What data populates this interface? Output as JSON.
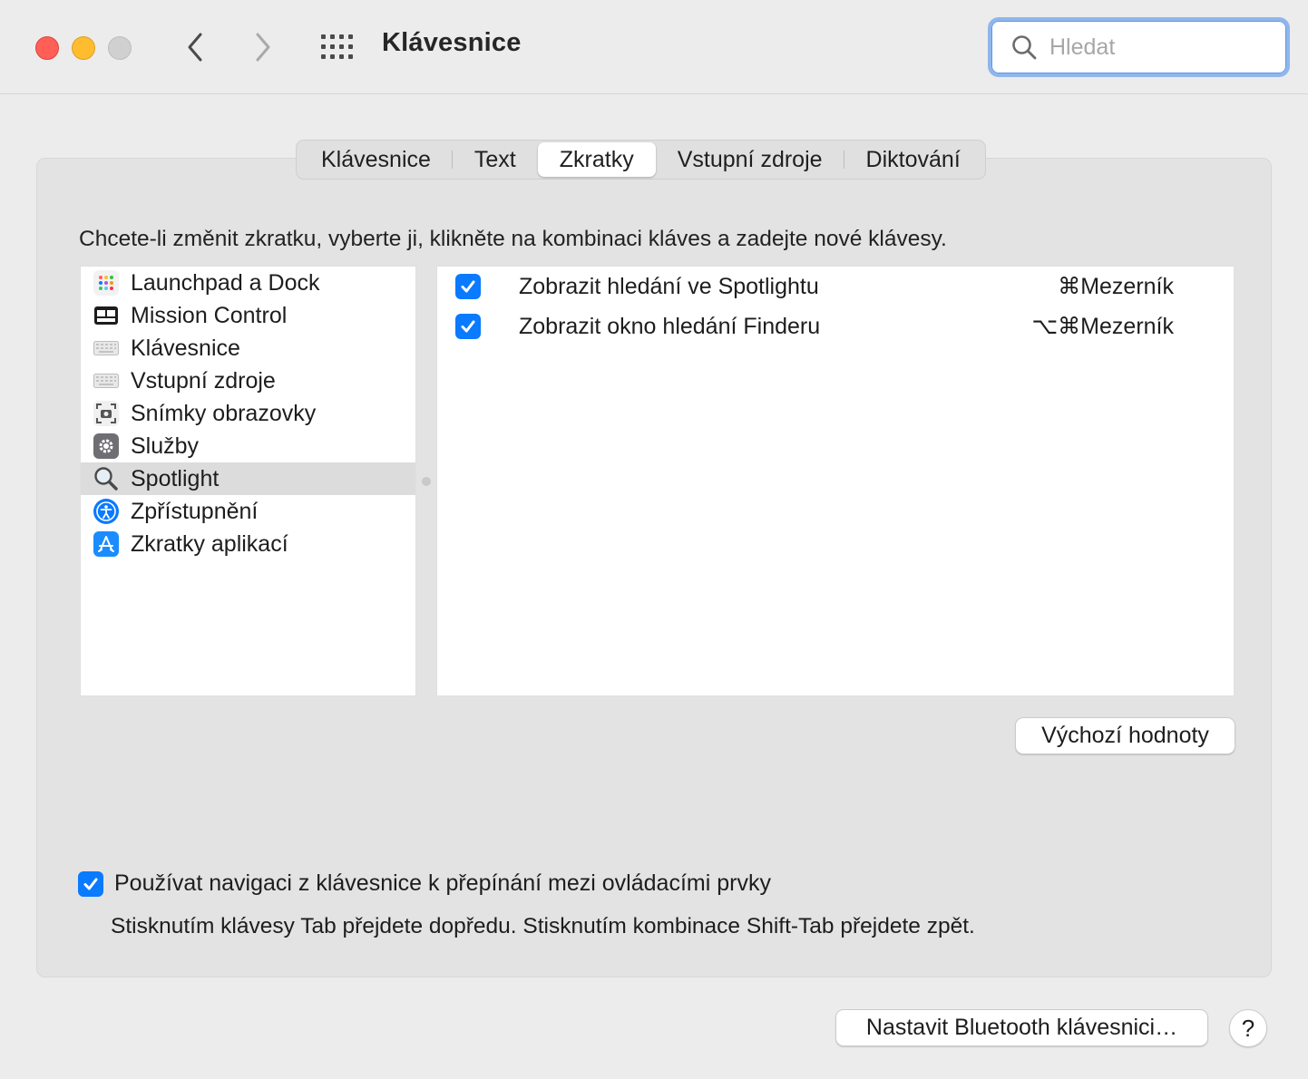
{
  "window": {
    "title": "Klávesnice",
    "search_placeholder": "Hledat"
  },
  "tabs": [
    {
      "label": "Klávesnice",
      "active": false
    },
    {
      "label": "Text",
      "active": false
    },
    {
      "label": "Zkratky",
      "active": true
    },
    {
      "label": "Vstupní zdroje",
      "active": false
    },
    {
      "label": "Diktování",
      "active": false
    }
  ],
  "instruction": "Chcete-li změnit zkratku, vyberte ji, klikněte na kombinaci kláves a zadejte nové klávesy.",
  "categories": [
    {
      "label": "Launchpad a Dock",
      "icon": "launchpad-icon"
    },
    {
      "label": "Mission Control",
      "icon": "mission-control-icon"
    },
    {
      "label": "Klávesnice",
      "icon": "keyboard-icon"
    },
    {
      "label": "Vstupní zdroje",
      "icon": "keyboard-icon"
    },
    {
      "label": "Snímky obrazovky",
      "icon": "screenshot-icon"
    },
    {
      "label": "Služby",
      "icon": "gear-icon"
    },
    {
      "label": "Spotlight",
      "icon": "magnifier-icon",
      "selected": true
    },
    {
      "label": "Zpřístupnění",
      "icon": "accessibility-icon"
    },
    {
      "label": "Zkratky aplikací",
      "icon": "app-store-icon"
    }
  ],
  "shortcuts": [
    {
      "checked": true,
      "label": "Zobrazit hledání ve Spotlightu",
      "keys": "⌘Mezerník"
    },
    {
      "checked": true,
      "label": "Zobrazit okno hledání Finderu",
      "keys": "⌥⌘Mezerník"
    }
  ],
  "buttons": {
    "defaults": "Výchozí hodnoty",
    "bluetooth": "Nastavit Bluetooth klávesnici…",
    "help": "?"
  },
  "keyboard_navigation": {
    "checked": true,
    "label": "Používat navigaci z klávesnice k přepínání mezi ovládacími prvky",
    "description": "Stisknutím klávesy Tab přejdete dopředu. Stisknutím kombinace Shift-Tab přejdete zpět."
  },
  "colors": {
    "accent": "#0a7aff",
    "close": "#ff5f57",
    "minimize": "#febc2e",
    "zoom_disabled": "#d0d0d0"
  }
}
